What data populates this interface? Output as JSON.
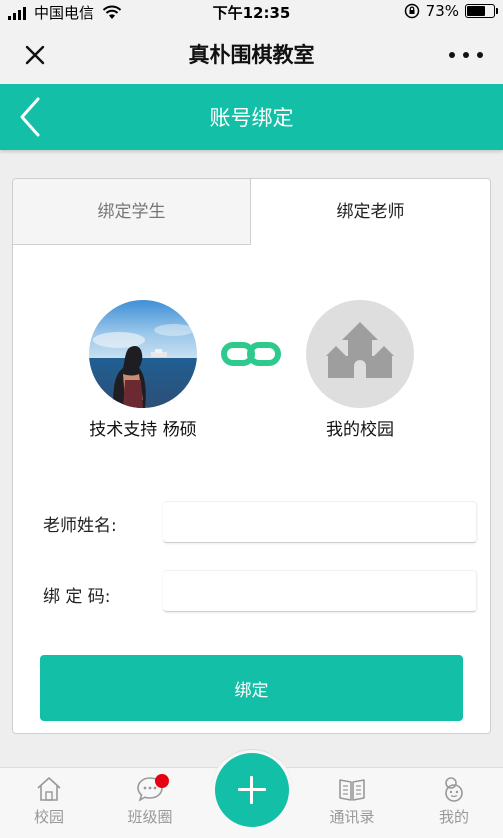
{
  "status_bar": {
    "carrier": "中国电信",
    "time": "下午12:35",
    "battery": "73%",
    "battery_level": 0.73,
    "icons": [
      "signal-icon",
      "wifi-icon",
      "orientation-lock-icon",
      "battery-icon"
    ]
  },
  "wechat_header": {
    "title": "真朴围棋教室",
    "icons": [
      "close-icon",
      "more-icon"
    ]
  },
  "page_header": {
    "title": "账号绑定",
    "icons": [
      "back-icon"
    ]
  },
  "tabs": {
    "student": "绑定学生",
    "teacher": "绑定老师",
    "active": "teacher"
  },
  "profile": {
    "user_name": "技术支持 杨硕",
    "school_name": "我的校园",
    "icons": [
      "avatar",
      "link-icon",
      "castle-icon"
    ]
  },
  "form": {
    "teacher_name_label": "老师姓名:",
    "teacher_name_value": "",
    "bind_code_label": "绑 定 码:",
    "bind_code_value": "",
    "submit_label": "绑定"
  },
  "tab_bar": {
    "items": [
      {
        "label": "校园",
        "icon": "home-icon"
      },
      {
        "label": "班级圈",
        "icon": "chat-bubble-icon",
        "badge": true
      },
      {
        "label": "",
        "icon": "plus-icon"
      },
      {
        "label": "通讯录",
        "icon": "book-icon"
      },
      {
        "label": "我的",
        "icon": "profile-icon"
      }
    ]
  },
  "colors": {
    "accent": "#14bfa7",
    "link_icon": "#2ec98c",
    "badge": "#e60012",
    "tab_inactive": "#999999"
  }
}
